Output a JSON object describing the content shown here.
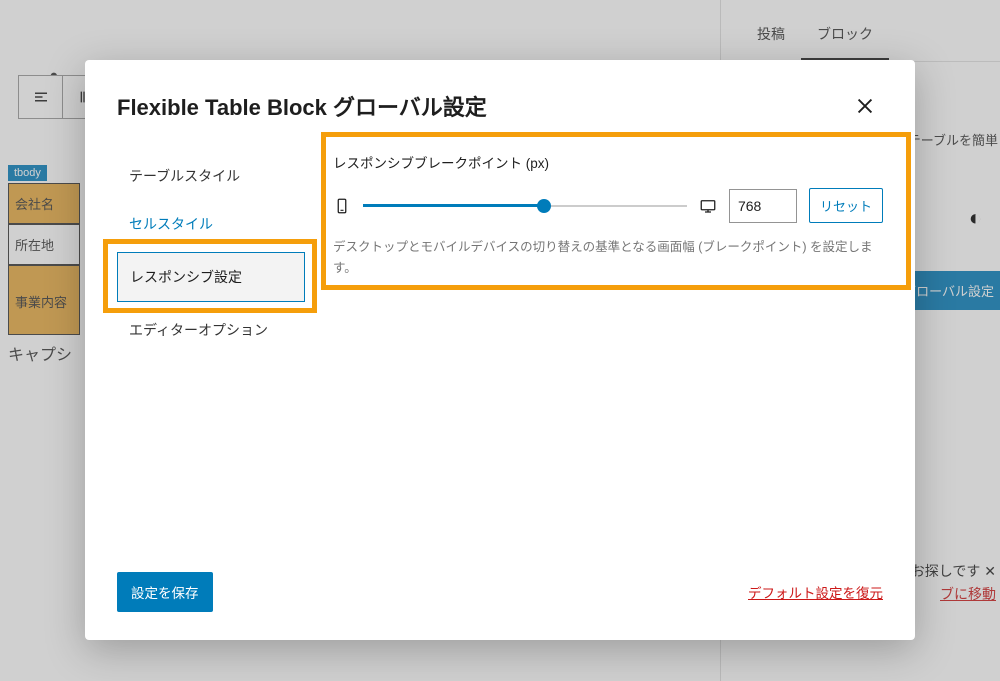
{
  "background": {
    "toolbar": {
      "icon1": "menu",
      "icon2": "paragraph"
    },
    "dot": "•",
    "tbody_tag": "tbody",
    "rows": [
      "会社名",
      "所在地",
      "事業内容"
    ],
    "caption": "キャプシ",
    "sidebar": {
      "tabs": [
        "投稿",
        "ブロック"
      ],
      "text_truncated": "テーブルを簡単",
      "contrast": "◐",
      "global_btn": "グローバル設定",
      "footer_line1": "お探しです  ✕",
      "footer_line2": "ブに移動"
    }
  },
  "modal": {
    "title": "Flexible Table Block グローバル設定",
    "tabs": {
      "table_style": "テーブルスタイル",
      "cell_style": "セルスタイル",
      "responsive": "レスポンシブ設定",
      "editor_options": "エディターオプション"
    },
    "responsive": {
      "label": "レスポンシブブレークポイント (px)",
      "value": "768",
      "reset": "リセット",
      "help": "デスクトップとモバイルデバイスの切り替えの基準となる画面幅 (ブレークポイント) を設定します。"
    },
    "footer": {
      "save": "設定を保存",
      "restore": "デフォルト設定を復元"
    }
  }
}
